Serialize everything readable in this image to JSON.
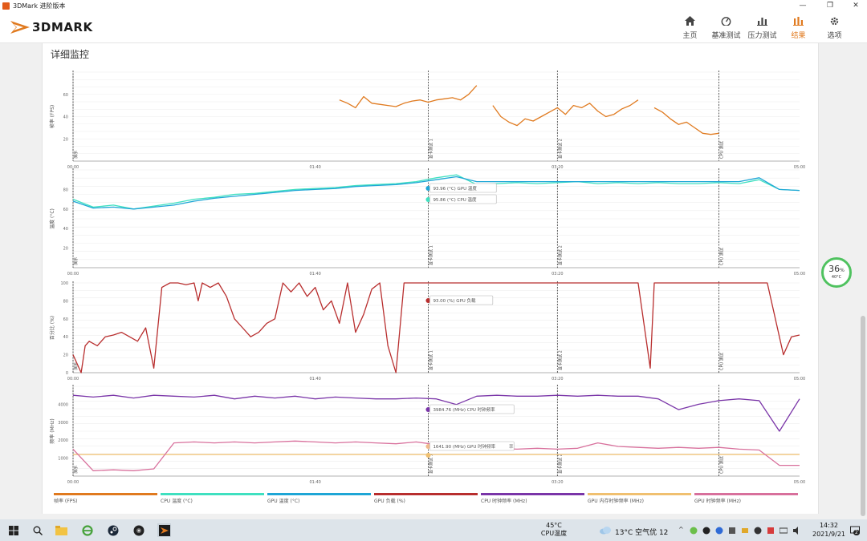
{
  "window": {
    "title": "3DMark 进阶版本",
    "minimize": "—",
    "restore": "❐",
    "close": "✕"
  },
  "brand": {
    "logo_text": "3DMARK",
    "accent": "#e07a1f"
  },
  "nav": [
    {
      "label": "主页",
      "icon": "home-icon",
      "active": false
    },
    {
      "label": "基准测试",
      "icon": "gauge-icon",
      "active": false
    },
    {
      "label": "压力测试",
      "icon": "bars-icon",
      "active": false
    },
    {
      "label": "结果",
      "icon": "results-icon",
      "active": true
    },
    {
      "label": "选项",
      "icon": "gear-icon",
      "active": false
    }
  ],
  "section": {
    "title": "详细监控"
  },
  "markers": [
    "演示",
    "显卡测试 1",
    "显卡测试 2",
    "CPU 测试"
  ],
  "x_ticks": [
    "00:00",
    "01:40",
    "03:20",
    "05:00"
  ],
  "tooltips": {
    "gpu_temp": "93.96 (°C) GPU 温度",
    "cpu_temp": "95.86 (°C) CPU 温度",
    "gpu_load": "93.00 (%) GPU 负载",
    "cpu_clock": "3984.76 (MHz) CPU 时钟频率",
    "gpu_clock": "1641.90 (MHz) GPU 时钟频率",
    "gpu_clock_tail": "率"
  },
  "legend": [
    {
      "label": "帧率 (FPS)",
      "color": "#e07a1f"
    },
    {
      "label": "CPU 温度 (°C)",
      "color": "#3fe0c0"
    },
    {
      "label": "GPU 温度 (°C)",
      "color": "#1ea6d6"
    },
    {
      "label": "GPU 负载 (%)",
      "color": "#b82e2e"
    },
    {
      "label": "CPU 时钟频率 (MHz)",
      "color": "#7a35a8"
    },
    {
      "label": "GPU 内存时钟频率 (MHz)",
      "color": "#f0c070"
    },
    {
      "label": "GPU 时钟频率 (MHz)",
      "color": "#d8709c"
    }
  ],
  "chart_data": [
    {
      "type": "line",
      "ylabel": "帧率 (FPS)",
      "yticks": [
        20,
        40,
        60
      ],
      "ylim": [
        0,
        80
      ],
      "x": [
        0,
        330,
        340,
        350,
        360,
        370,
        380,
        390,
        400,
        410,
        420,
        430,
        440,
        450,
        460,
        470,
        480,
        490,
        500,
        510,
        520,
        530,
        540,
        550,
        560,
        570,
        580,
        590,
        600,
        610,
        620,
        630,
        640,
        650,
        660,
        670,
        680,
        690,
        700,
        710,
        720,
        730,
        740,
        750,
        760,
        770,
        780,
        790,
        800,
        810,
        820,
        830,
        840,
        850,
        860,
        870,
        880,
        890,
        900
      ],
      "series": [
        {
          "name": "帧率 (FPS)",
          "color": "#e07a1f",
          "values": [
            null,
            55,
            52,
            48,
            58,
            52,
            51,
            50,
            49,
            52,
            54,
            55,
            53,
            55,
            56,
            57,
            55,
            60,
            68,
            null,
            50,
            40,
            35,
            32,
            38,
            36,
            40,
            44,
            48,
            42,
            50,
            48,
            52,
            45,
            40,
            42,
            47,
            50,
            55,
            null,
            48,
            44,
            38,
            33,
            35,
            30,
            25,
            24,
            25,
            null,
            null,
            null,
            null,
            null,
            null,
            null,
            null,
            null,
            null
          ]
        }
      ]
    },
    {
      "type": "line",
      "ylabel": "温度 (°C)",
      "yticks": [
        20,
        40,
        60,
        80
      ],
      "ylim": [
        0,
        100
      ],
      "x": [
        0,
        25,
        50,
        75,
        100,
        125,
        150,
        175,
        200,
        225,
        250,
        275,
        300,
        325,
        350,
        375,
        400,
        425,
        450,
        475,
        500,
        525,
        550,
        575,
        600,
        625,
        650,
        675,
        700,
        725,
        750,
        775,
        800,
        825,
        850,
        875,
        900
      ],
      "series": [
        {
          "name": "CPU 温度 (°C)",
          "color": "#3fe0c0",
          "values": [
            70,
            62,
            64,
            60,
            63,
            66,
            70,
            72,
            75,
            76,
            78,
            80,
            81,
            82,
            84,
            85,
            86,
            88,
            92,
            95,
            85,
            86,
            87,
            86,
            87,
            88,
            86,
            87,
            86,
            87,
            86,
            86,
            87,
            86,
            90,
            80,
            79
          ]
        },
        {
          "name": "GPU 温度 (°C)",
          "color": "#1ea6d6",
          "values": [
            68,
            61,
            62,
            60,
            62,
            64,
            68,
            71,
            73,
            75,
            77,
            79,
            80,
            81,
            83,
            84,
            85,
            87,
            90,
            93,
            88,
            88,
            88,
            88,
            88,
            88,
            88,
            88,
            88,
            88,
            88,
            88,
            88,
            88,
            92,
            80,
            79
          ]
        }
      ]
    },
    {
      "type": "line",
      "ylabel": "百分比 (%)",
      "yticks": [
        0,
        20,
        40,
        60,
        80,
        100
      ],
      "ylim": [
        0,
        100
      ],
      "x": [
        0,
        10,
        15,
        20,
        30,
        40,
        50,
        60,
        70,
        80,
        90,
        100,
        110,
        120,
        130,
        140,
        150,
        155,
        160,
        170,
        180,
        190,
        200,
        210,
        220,
        230,
        240,
        250,
        260,
        270,
        280,
        290,
        300,
        310,
        320,
        330,
        340,
        350,
        360,
        370,
        380,
        390,
        400,
        410,
        420,
        430,
        440,
        450,
        460,
        470,
        480,
        490,
        495,
        500,
        510,
        520,
        580,
        600,
        620,
        640,
        660,
        680,
        700,
        715,
        720,
        730,
        750,
        780,
        800,
        820,
        840,
        860,
        880,
        890,
        900
      ],
      "series": [
        {
          "name": "GPU 负载 (%)",
          "color": "#b82e2e",
          "values": [
            20,
            0,
            30,
            35,
            30,
            40,
            42,
            45,
            40,
            35,
            50,
            5,
            95,
            100,
            100,
            98,
            100,
            80,
            100,
            95,
            100,
            85,
            60,
            50,
            40,
            45,
            55,
            60,
            100,
            90,
            100,
            85,
            95,
            70,
            80,
            55,
            100,
            45,
            65,
            93,
            100,
            30,
            0,
            100,
            100,
            100,
            100,
            100,
            100,
            100,
            100,
            100,
            100,
            100,
            100,
            100,
            100,
            100,
            100,
            100,
            100,
            100,
            100,
            5,
            100,
            100,
            100,
            100,
            100,
            100,
            100,
            100,
            20,
            40,
            42
          ]
        }
      ]
    },
    {
      "type": "line",
      "ylabel": "频率 (MHz)",
      "yticks": [
        1000,
        2000,
        3000,
        4000
      ],
      "ylim": [
        0,
        5000
      ],
      "x": [
        0,
        25,
        50,
        75,
        100,
        125,
        150,
        175,
        200,
        225,
        250,
        275,
        300,
        325,
        350,
        375,
        400,
        425,
        450,
        475,
        500,
        525,
        550,
        575,
        600,
        625,
        650,
        675,
        700,
        725,
        750,
        775,
        800,
        825,
        850,
        875,
        900
      ],
      "series": [
        {
          "name": "CPU 时钟频率 (MHz)",
          "color": "#7a35a8",
          "values": [
            4500,
            4400,
            4500,
            4350,
            4500,
            4450,
            4400,
            4500,
            4300,
            4450,
            4350,
            4450,
            4300,
            4400,
            4350,
            4300,
            4300,
            4350,
            4300,
            3985,
            4450,
            4500,
            4450,
            4450,
            4500,
            4450,
            4500,
            4450,
            4450,
            4300,
            3700,
            4000,
            4200,
            4300,
            4200,
            2500,
            4300
          ]
        },
        {
          "name": "GPU 内存时钟频率 (MHz)",
          "color": "#f0c070",
          "values": [
            1200,
            1200,
            1200,
            1200,
            1200,
            1200,
            1200,
            1200,
            1200,
            1200,
            1200,
            1200,
            1200,
            1200,
            1200,
            1200,
            1200,
            1200,
            1200,
            1200,
            1200,
            1200,
            1200,
            1200,
            1200,
            1200,
            1200,
            1200,
            1200,
            1200,
            1200,
            1200,
            1200,
            1200,
            1200,
            1200,
            1200
          ]
        },
        {
          "name": "GPU 时钟频率 (MHz)",
          "color": "#d8709c",
          "values": [
            1500,
            300,
            350,
            300,
            400,
            1850,
            1900,
            1850,
            1900,
            1850,
            1900,
            1950,
            1900,
            1850,
            1900,
            1850,
            1800,
            1900,
            1750,
            1642,
            1500,
            1550,
            1500,
            1550,
            1500,
            1550,
            1850,
            1650,
            1600,
            1550,
            1600,
            1550,
            1600,
            1500,
            1450,
            600,
            600
          ]
        }
      ]
    }
  ],
  "widget": {
    "percent": "36",
    "percent_unit": "%",
    "temp": "40°C"
  },
  "taskbar": {
    "cpu_temp_value": "45°C",
    "cpu_temp_label": "CPU温度",
    "weather": "13°C  空气优 12",
    "time": "14:32",
    "date": "2021/9/21",
    "notif_count": "2"
  }
}
